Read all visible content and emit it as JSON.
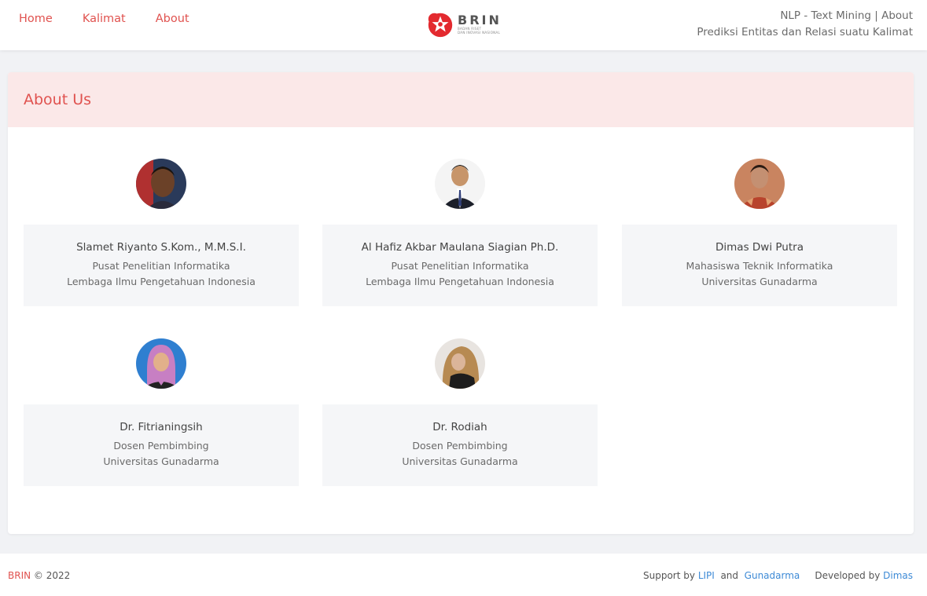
{
  "nav": {
    "links": [
      "Home",
      "Kalimat",
      "About"
    ],
    "logo_word": "BRIN",
    "logo_sub_1": "BADAN RISET",
    "logo_sub_2": "DAN INOVASI NASIONAL",
    "right_line1": "NLP - Text Mining | About",
    "right_line2": "Prediksi Entitas dan Relasi suatu Kalimat"
  },
  "card": {
    "title": "About Us"
  },
  "members": [
    {
      "name": "Slamet Riyanto S.Kom., M.M.S.I.",
      "line1": "Pusat Penelitian Informatika",
      "line2": "Lembaga Ilmu Pengetahuan Indonesia"
    },
    {
      "name": "Al Hafiz Akbar Maulana Siagian Ph.D.",
      "line1": "Pusat Penelitian Informatika",
      "line2": "Lembaga Ilmu Pengetahuan Indonesia"
    },
    {
      "name": "Dimas Dwi Putra",
      "line1": "Mahasiswa Teknik Informatika",
      "line2": "Universitas Gunadarma"
    },
    {
      "name": "Dr. Fitrianingsih",
      "line1": "Dosen Pembimbing",
      "line2": "Universitas Gunadarma"
    },
    {
      "name": "Dr. Rodiah",
      "line1": "Dosen Pembimbing",
      "line2": "Universitas Gunadarma"
    }
  ],
  "footer": {
    "brand": "BRIN",
    "copyright": "© 2022",
    "support_prefix": "Support by",
    "support_1": "LIPI",
    "and": "and",
    "support_2": "Gunadarma",
    "developed_prefix": "Developed by",
    "developer": "Dimas"
  },
  "colors": {
    "accent": "#e0524f",
    "link_blue": "#3d8ad6",
    "header_bg": "#fbe8e8",
    "page_bg": "#f1f2f5"
  }
}
